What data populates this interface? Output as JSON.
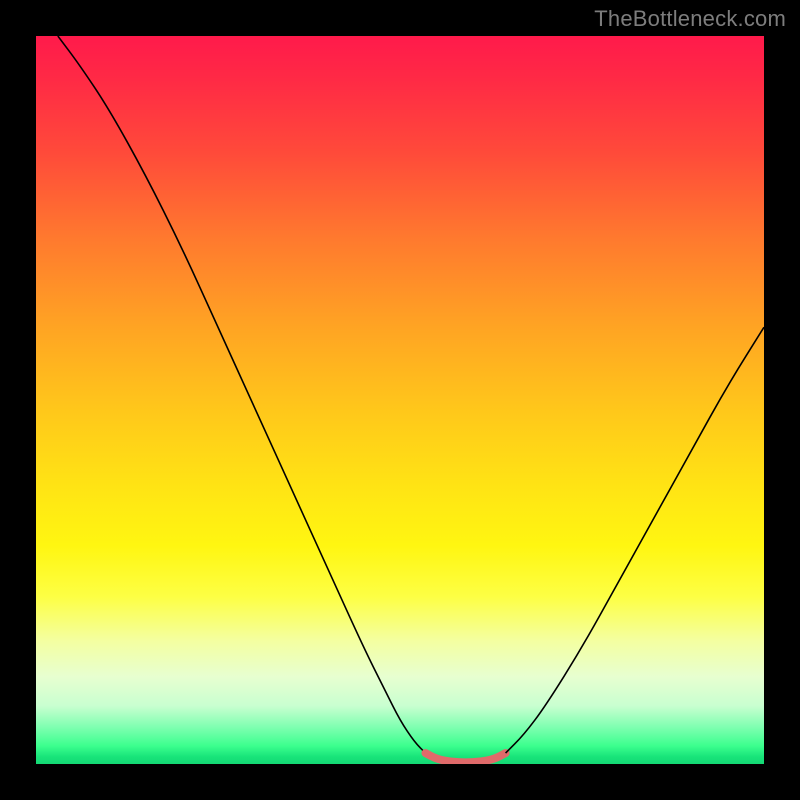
{
  "watermark": {
    "text": "TheBottleneck.com"
  },
  "chart_data": {
    "type": "line",
    "title": "",
    "xlabel": "",
    "ylabel": "",
    "xlim": [
      0,
      100
    ],
    "ylim": [
      0,
      100
    ],
    "grid": false,
    "legend": false,
    "background_gradient": {
      "direction": "vertical",
      "stops": [
        {
          "pos": 0.0,
          "color": "#ff1a4b"
        },
        {
          "pos": 0.28,
          "color": "#ff7a2e"
        },
        {
          "pos": 0.55,
          "color": "#ffd418"
        },
        {
          "pos": 0.8,
          "color": "#f8ff70"
        },
        {
          "pos": 0.92,
          "color": "#c9ffd0"
        },
        {
          "pos": 1.0,
          "color": "#14d874"
        }
      ]
    },
    "series": [
      {
        "name": "left-descent",
        "stroke": "#000000",
        "stroke_width": 1.4,
        "points_xy": [
          [
            3,
            100
          ],
          [
            6,
            96
          ],
          [
            10,
            90
          ],
          [
            15,
            81
          ],
          [
            20,
            71
          ],
          [
            25,
            60
          ],
          [
            30,
            49
          ],
          [
            35,
            38
          ],
          [
            40,
            27
          ],
          [
            45,
            16
          ],
          [
            48,
            10
          ],
          [
            50,
            6
          ],
          [
            52,
            3
          ],
          [
            53.5,
            1.5
          ]
        ]
      },
      {
        "name": "valley-floor",
        "stroke": "#e06a6a",
        "stroke_width": 5,
        "points_xy": [
          [
            53.5,
            1.5
          ],
          [
            55,
            0.7
          ],
          [
            57,
            0.3
          ],
          [
            59,
            0.2
          ],
          [
            61,
            0.3
          ],
          [
            63,
            0.7
          ],
          [
            64.5,
            1.5
          ]
        ]
      },
      {
        "name": "right-ascent",
        "stroke": "#000000",
        "stroke_width": 1.4,
        "points_xy": [
          [
            64.5,
            1.5
          ],
          [
            67,
            4
          ],
          [
            70,
            8
          ],
          [
            75,
            16
          ],
          [
            80,
            25
          ],
          [
            85,
            34
          ],
          [
            90,
            43
          ],
          [
            95,
            52
          ],
          [
            100,
            60
          ]
        ]
      }
    ],
    "annotations": []
  }
}
